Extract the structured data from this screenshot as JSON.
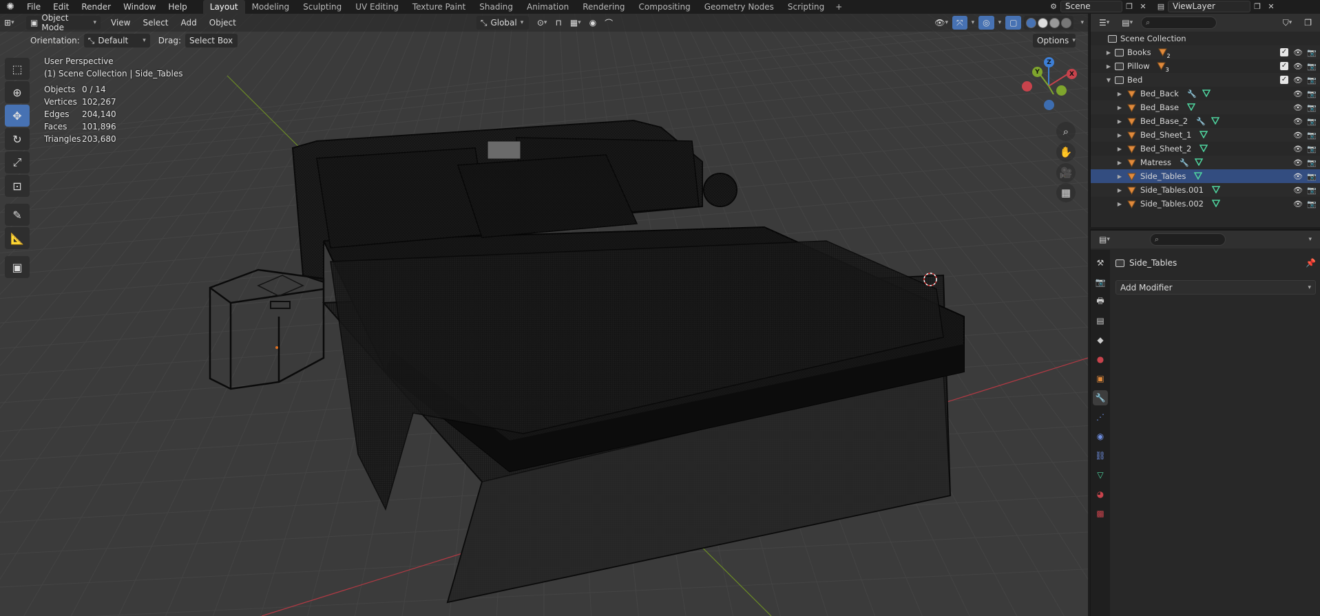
{
  "topbar": {
    "menus": [
      "File",
      "Edit",
      "Render",
      "Window",
      "Help"
    ],
    "workspaces": [
      "Layout",
      "Modeling",
      "Sculpting",
      "UV Editing",
      "Texture Paint",
      "Shading",
      "Animation",
      "Rendering",
      "Compositing",
      "Geometry Nodes",
      "Scripting"
    ],
    "active_workspace": "Layout",
    "add_tab": "+",
    "scene": "Scene",
    "view_layer": "ViewLayer"
  },
  "viewport": {
    "mode": "Object Mode",
    "menus": [
      "View",
      "Select",
      "Add",
      "Object"
    ],
    "transform_orientation": "Global",
    "orientation_label": "Orientation:",
    "orientation_value": "Default",
    "drag_label": "Drag:",
    "drag_value": "Select Box",
    "options_label": "Options",
    "perspective": "User Perspective",
    "context": "(1) Scene Collection | Side_Tables",
    "stats": [
      {
        "label": "Objects",
        "value": "0 / 14"
      },
      {
        "label": "Vertices",
        "value": "102,267"
      },
      {
        "label": "Edges",
        "value": "204,140"
      },
      {
        "label": "Faces",
        "value": "101,896"
      },
      {
        "label": "Triangles",
        "value": "203,680"
      }
    ],
    "gizmo": {
      "z": "Z",
      "y": "Y",
      "x": "X"
    },
    "colors": {
      "x_axis": "#c8434c",
      "y_axis": "#7fa52d",
      "z_axis": "#3d7fd6",
      "grid": "#444444",
      "background": "#3b3b3b",
      "wire": "#0d0d0d"
    }
  },
  "outliner": {
    "root": "Scene Collection",
    "items": [
      {
        "name": "Books",
        "type": "collection",
        "count": "2",
        "depth": 1
      },
      {
        "name": "Pillow",
        "type": "collection",
        "count": "3",
        "depth": 1
      },
      {
        "name": "Bed",
        "type": "collection",
        "expanded": true,
        "depth": 1
      },
      {
        "name": "Bed_Back",
        "type": "object",
        "modifier": true,
        "depth": 2
      },
      {
        "name": "Bed_Base",
        "type": "object",
        "modifier": false,
        "depth": 2
      },
      {
        "name": "Bed_Base_2",
        "type": "object",
        "modifier": true,
        "depth": 2
      },
      {
        "name": "Bed_Sheet_1",
        "type": "object",
        "modifier": false,
        "depth": 2
      },
      {
        "name": "Bed_Sheet_2",
        "type": "object",
        "modifier": false,
        "depth": 2
      },
      {
        "name": "Matress",
        "type": "object",
        "modifier": true,
        "depth": 2
      },
      {
        "name": "Side_Tables",
        "type": "object",
        "modifier": false,
        "depth": 2,
        "active": true
      },
      {
        "name": "Side_Tables.001",
        "type": "object",
        "modifier": false,
        "depth": 2
      },
      {
        "name": "Side_Tables.002",
        "type": "object",
        "modifier": false,
        "depth": 2
      }
    ]
  },
  "properties": {
    "object_name": "Side_Tables",
    "add_modifier": "Add Modifier"
  }
}
